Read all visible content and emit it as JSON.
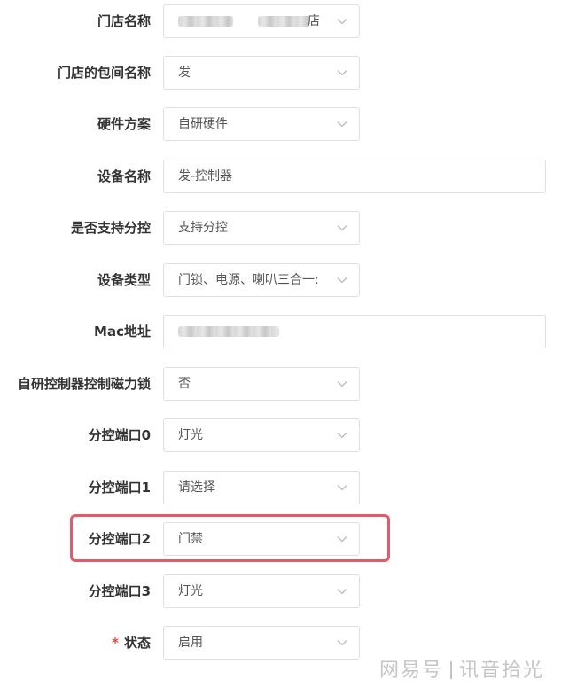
{
  "form": {
    "store_name": {
      "label": "门店名称",
      "value": "店"
    },
    "room_name": {
      "label": "门店的包间名称",
      "value": "发"
    },
    "hardware_plan": {
      "label": "硬件方案",
      "value": "自研硬件"
    },
    "device_name": {
      "label": "设备名称",
      "value": "发-控制器"
    },
    "sub_control": {
      "label": "是否支持分控",
      "value": "支持分控"
    },
    "device_type": {
      "label": "设备类型",
      "value": "门锁、电源、喇叭三合一:"
    },
    "mac_address": {
      "label": "Mac地址",
      "value": ""
    },
    "magnetic_lock": {
      "label": "自研控制器控制磁力锁",
      "value": "否"
    },
    "port0": {
      "label": "分控端口0",
      "value": "灯光"
    },
    "port1": {
      "label": "分控端口1",
      "value": "请选择"
    },
    "port2": {
      "label": "分控端口2",
      "value": "门禁"
    },
    "port3": {
      "label": "分控端口3",
      "value": "灯光"
    },
    "status": {
      "label": "状态",
      "value": "启用",
      "required_mark": "*"
    }
  },
  "icons": {
    "select_arrow": "chevron-down-icon"
  },
  "colors": {
    "highlight": "#e45a6a",
    "required": "#e8483f",
    "border": "#dcdfe6"
  },
  "watermark": {
    "platform": "网易号",
    "author": "讯音拾光"
  }
}
